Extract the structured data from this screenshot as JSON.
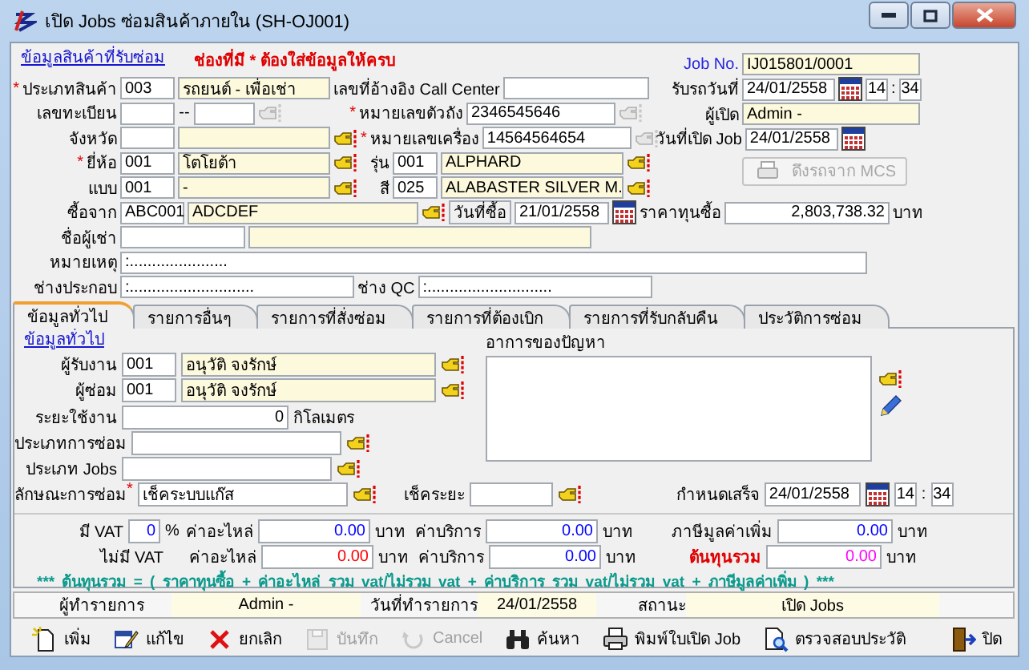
{
  "window": {
    "title": "เปิด Jobs ซ่อมสินค้าภายใน (SH-OJ001)"
  },
  "product_section": {
    "link": "ข้อมูลสินค้าที่รับซ่อม",
    "note": "ช่องที่มี * ต้องใส่ข้อมูลให้ครบ"
  },
  "product_type": {
    "label": "ประเภทสินค้า",
    "mark": "*",
    "code": "003",
    "name": "รถยนต์ - เพื่อเช่า"
  },
  "call_center": {
    "label": "เลขที่อ้างอิง Call Center"
  },
  "plate": {
    "label": "เลขทะเบียน",
    "separator": "--",
    "lookup_disabled": true
  },
  "province": {
    "label": "จังหวัด",
    "lookup_disabled": false
  },
  "chassis": {
    "label": "หมายเลขตัวถัง",
    "mark": "*",
    "value": "2346545646",
    "lookup_disabled": true
  },
  "engine": {
    "label": "หมายเลขเครื่อง",
    "mark": "*",
    "value": "14564564654",
    "lookup_disabled": true
  },
  "brand": {
    "label": "ยี่ห้อ",
    "mark": "*",
    "code": "001",
    "name": "โตโยต้า",
    "lookup_disabled": false
  },
  "model": {
    "label": "รุ่น",
    "code": "001",
    "name": "ALPHARD",
    "lookup_disabled": false
  },
  "variant": {
    "label": "แบบ",
    "code": "001",
    "name": "-",
    "lookup_disabled": false
  },
  "paint": {
    "label": "สี",
    "code": "025",
    "name": "ALABASTER SILVER M.",
    "lookup_disabled": false
  },
  "seller": {
    "label": "ซื้อจาก",
    "code": "ABC001",
    "name": "ADCDEF",
    "lookup_disabled": false
  },
  "purchase_date": {
    "label": "วันที่ซื้อ",
    "value": "21/01/2558"
  },
  "purchase_cost": {
    "label": "ราคาทุนซื้อ",
    "value": "2,803,738.32",
    "unit": "บาท"
  },
  "renter": {
    "label": "ชื่อผู้เช่า"
  },
  "remark": {
    "label": "หมายเหตุ",
    "value": ":......................"
  },
  "assembler": {
    "label": "ช่างประกอบ",
    "value": ":............................"
  },
  "qc": {
    "label": "ช่าง QC",
    "value": ":............................"
  },
  "job": {
    "label": "Job No.",
    "value": "IJ015801/0001"
  },
  "received": {
    "label": "รับรถวันที่",
    "date": "24/01/2558",
    "hour": "14",
    "separator": ":",
    "minute": "34"
  },
  "opener": {
    "label": "ผู้เปิด",
    "value": "Admin -"
  },
  "open_date": {
    "label": "วันที่เปิด Job",
    "value": "24/01/2558"
  },
  "mcs_button": {
    "label": "ดึงรถจาก MCS",
    "disabled": true
  },
  "tabs": [
    {
      "label": "ข้อมูลทั่วไป",
      "selected": true
    },
    {
      "label": "รายการอื่นๆ",
      "selected": false
    },
    {
      "label": "รายการที่สั่งซ่อม",
      "selected": false
    },
    {
      "label": "รายการที่ต้องเบิก",
      "selected": false
    },
    {
      "label": "รายการที่รับกลับคืน",
      "selected": false
    },
    {
      "label": "ประวัติการซ่อม",
      "selected": false
    }
  ],
  "general": {
    "link": "ข้อมูลทั่วไป",
    "receiver": {
      "label": "ผู้รับงาน",
      "code": "001",
      "name": "อนุวัติ จงรักษ์",
      "lookup_disabled": false
    },
    "repairer": {
      "label": "ผู้ซ่อม",
      "code": "001",
      "name": "อนุวัติ จงรักษ์",
      "lookup_disabled": false
    },
    "mileage": {
      "label": "ระยะใช้งาน",
      "value": "0",
      "unit": "กิโลเมตร"
    },
    "repair_type": {
      "label": "ประเภทการซ่อม",
      "lookup_disabled": false
    },
    "job_type": {
      "label": "ประเภท Jobs",
      "lookup_disabled": false
    },
    "repair_nature": {
      "label": "ลักษณะการซ่อม",
      "mark_after": "*",
      "value": "เช็คระบบแก๊ส",
      "lookup_disabled": false
    },
    "check_interval": {
      "label": "เช็คระยะ",
      "lookup_disabled": false
    },
    "due": {
      "label": "กำหนดเสร็จ",
      "date": "24/01/2558",
      "hour": "14",
      "separator": ":",
      "minute": "34"
    },
    "symptoms": {
      "label": "อาการของปัญหา",
      "lookup_disabled": false
    }
  },
  "costs": {
    "vat_label": "มี VAT",
    "vat_rate": {
      "value": "0",
      "color": "#0000ff"
    },
    "percent": "%",
    "novat_label": "ไม่มี VAT",
    "vat_parts": {
      "label": "ค่าอะไหล่",
      "value": "0.00",
      "color": "#0000ff",
      "unit": "บาท"
    },
    "vat_service": {
      "label": "ค่าบริการ",
      "value": "0.00",
      "color": "#0000ff",
      "unit": "บาท"
    },
    "tax": {
      "label": "ภาษีมูลค่าเพิ่ม",
      "value": "0.00",
      "color": "#0000ff",
      "unit": "บาท"
    },
    "novat_parts": {
      "label": "ค่าอะไหล่",
      "value": "0.00",
      "color": "#ff0000",
      "unit": "บาท"
    },
    "novat_service": {
      "label": "ค่าบริการ",
      "value": "0.00",
      "color": "#0000ff",
      "unit": "บาท"
    },
    "total": {
      "label": "ต้นทุนรวม",
      "value": "0.00",
      "color": "#ff00ff",
      "unit": "บาท"
    },
    "formula": "*** ต้นทุนรวม = ( ราคาทุนซื้อ + ค่าอะไหล่ รวม vat/ไม่รวม vat + ค่าบริการ รวม vat/ไม่รวม vat + ภาษีมูลค่าเพิ่ม ) ***"
  },
  "status_bar": {
    "user_label": "ผู้ทำรายการ",
    "user": "Admin -",
    "date_label": "วันที่ทำรายการ",
    "date": "24/01/2558",
    "state_label": "สถานะ",
    "state": "เปิด Jobs"
  },
  "toolbar": [
    {
      "label": "เพิ่ม",
      "kind": "new",
      "disabled": false
    },
    {
      "label": "แก้ไข",
      "kind": "edit",
      "disabled": false
    },
    {
      "label": "ยกเลิก",
      "kind": "delete",
      "disabled": false
    },
    {
      "label": "บันทึก",
      "kind": "save",
      "disabled": true
    },
    {
      "label": "Cancel",
      "kind": "undo",
      "disabled": true
    },
    {
      "label": "ค้นหา",
      "kind": "search",
      "disabled": false
    },
    {
      "label": "พิมพ์ใบเปิด Job",
      "kind": "print",
      "disabled": false
    },
    {
      "label": "ตรวจสอบประวัติ",
      "kind": "history",
      "disabled": false
    },
    {
      "label": "ปิด",
      "kind": "exit",
      "disabled": false
    }
  ]
}
